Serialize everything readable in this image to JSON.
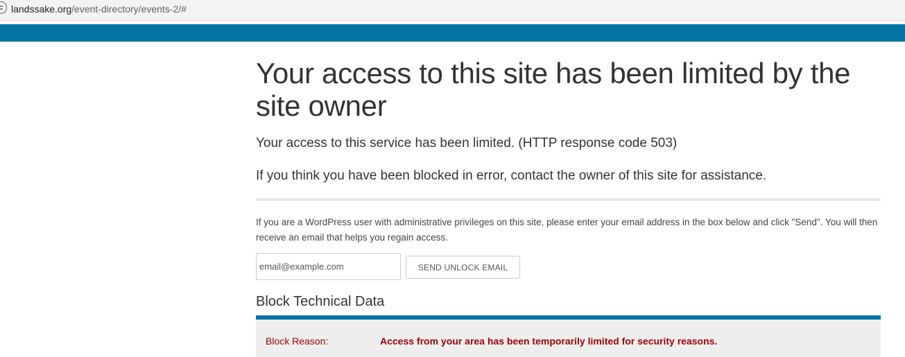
{
  "browser": {
    "url_domain": "landssake.org",
    "url_path": "/event-directory/events-2/#"
  },
  "main": {
    "title": "Your access to this site has been limited by the site owner",
    "message": "Your access to this service has been limited. (HTTP response code 503)",
    "contact_note": "If you think you have been blocked in error, contact the owner of this site for assistance.",
    "admin_note": "If you are a WordPress user with administrative privileges on this site, please enter your email address in the box below and click \"Send\". You will then receive an email that helps you regain access.",
    "email_placeholder": "email@example.com",
    "send_button": "SEND UNLOCK EMAIL",
    "tech_title": "Block Technical Data",
    "tech_rows": [
      {
        "label": "Block Reason:",
        "value": "Access from your area has been temporarily limited for security reasons."
      }
    ]
  },
  "colors": {
    "accent_bar": "#0074a2",
    "error_text": "#9f0000",
    "table_bg": "#eeeeee"
  }
}
